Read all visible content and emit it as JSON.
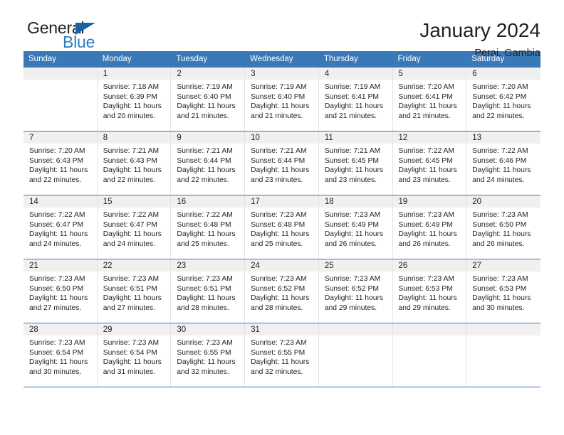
{
  "logo": {
    "word_one": "General",
    "word_two": "Blue",
    "triangle_color": "#1763a5",
    "blue_color": "#2b7cc4"
  },
  "header": {
    "title": "January 2024",
    "subtitle": "Perai, Gambia"
  },
  "colors": {
    "header_blue": "#3a79b8",
    "daynum_band": "#f0f0f0",
    "text": "#221f1f"
  },
  "weekday_headers": [
    "Sunday",
    "Monday",
    "Tuesday",
    "Wednesday",
    "Thursday",
    "Friday",
    "Saturday"
  ],
  "weeks": [
    [
      {
        "day": "",
        "sunrise": "",
        "sunset": "",
        "daylight_1": "",
        "daylight_2": ""
      },
      {
        "day": "1",
        "sunrise": "Sunrise: 7:18 AM",
        "sunset": "Sunset: 6:39 PM",
        "daylight_1": "Daylight: 11 hours",
        "daylight_2": "and 20 minutes."
      },
      {
        "day": "2",
        "sunrise": "Sunrise: 7:19 AM",
        "sunset": "Sunset: 6:40 PM",
        "daylight_1": "Daylight: 11 hours",
        "daylight_2": "and 21 minutes."
      },
      {
        "day": "3",
        "sunrise": "Sunrise: 7:19 AM",
        "sunset": "Sunset: 6:40 PM",
        "daylight_1": "Daylight: 11 hours",
        "daylight_2": "and 21 minutes."
      },
      {
        "day": "4",
        "sunrise": "Sunrise: 7:19 AM",
        "sunset": "Sunset: 6:41 PM",
        "daylight_1": "Daylight: 11 hours",
        "daylight_2": "and 21 minutes."
      },
      {
        "day": "5",
        "sunrise": "Sunrise: 7:20 AM",
        "sunset": "Sunset: 6:41 PM",
        "daylight_1": "Daylight: 11 hours",
        "daylight_2": "and 21 minutes."
      },
      {
        "day": "6",
        "sunrise": "Sunrise: 7:20 AM",
        "sunset": "Sunset: 6:42 PM",
        "daylight_1": "Daylight: 11 hours",
        "daylight_2": "and 22 minutes."
      }
    ],
    [
      {
        "day": "7",
        "sunrise": "Sunrise: 7:20 AM",
        "sunset": "Sunset: 6:43 PM",
        "daylight_1": "Daylight: 11 hours",
        "daylight_2": "and 22 minutes."
      },
      {
        "day": "8",
        "sunrise": "Sunrise: 7:21 AM",
        "sunset": "Sunset: 6:43 PM",
        "daylight_1": "Daylight: 11 hours",
        "daylight_2": "and 22 minutes."
      },
      {
        "day": "9",
        "sunrise": "Sunrise: 7:21 AM",
        "sunset": "Sunset: 6:44 PM",
        "daylight_1": "Daylight: 11 hours",
        "daylight_2": "and 22 minutes."
      },
      {
        "day": "10",
        "sunrise": "Sunrise: 7:21 AM",
        "sunset": "Sunset: 6:44 PM",
        "daylight_1": "Daylight: 11 hours",
        "daylight_2": "and 23 minutes."
      },
      {
        "day": "11",
        "sunrise": "Sunrise: 7:21 AM",
        "sunset": "Sunset: 6:45 PM",
        "daylight_1": "Daylight: 11 hours",
        "daylight_2": "and 23 minutes."
      },
      {
        "day": "12",
        "sunrise": "Sunrise: 7:22 AM",
        "sunset": "Sunset: 6:45 PM",
        "daylight_1": "Daylight: 11 hours",
        "daylight_2": "and 23 minutes."
      },
      {
        "day": "13",
        "sunrise": "Sunrise: 7:22 AM",
        "sunset": "Sunset: 6:46 PM",
        "daylight_1": "Daylight: 11 hours",
        "daylight_2": "and 24 minutes."
      }
    ],
    [
      {
        "day": "14",
        "sunrise": "Sunrise: 7:22 AM",
        "sunset": "Sunset: 6:47 PM",
        "daylight_1": "Daylight: 11 hours",
        "daylight_2": "and 24 minutes."
      },
      {
        "day": "15",
        "sunrise": "Sunrise: 7:22 AM",
        "sunset": "Sunset: 6:47 PM",
        "daylight_1": "Daylight: 11 hours",
        "daylight_2": "and 24 minutes."
      },
      {
        "day": "16",
        "sunrise": "Sunrise: 7:22 AM",
        "sunset": "Sunset: 6:48 PM",
        "daylight_1": "Daylight: 11 hours",
        "daylight_2": "and 25 minutes."
      },
      {
        "day": "17",
        "sunrise": "Sunrise: 7:23 AM",
        "sunset": "Sunset: 6:48 PM",
        "daylight_1": "Daylight: 11 hours",
        "daylight_2": "and 25 minutes."
      },
      {
        "day": "18",
        "sunrise": "Sunrise: 7:23 AM",
        "sunset": "Sunset: 6:49 PM",
        "daylight_1": "Daylight: 11 hours",
        "daylight_2": "and 26 minutes."
      },
      {
        "day": "19",
        "sunrise": "Sunrise: 7:23 AM",
        "sunset": "Sunset: 6:49 PM",
        "daylight_1": "Daylight: 11 hours",
        "daylight_2": "and 26 minutes."
      },
      {
        "day": "20",
        "sunrise": "Sunrise: 7:23 AM",
        "sunset": "Sunset: 6:50 PM",
        "daylight_1": "Daylight: 11 hours",
        "daylight_2": "and 26 minutes."
      }
    ],
    [
      {
        "day": "21",
        "sunrise": "Sunrise: 7:23 AM",
        "sunset": "Sunset: 6:50 PM",
        "daylight_1": "Daylight: 11 hours",
        "daylight_2": "and 27 minutes."
      },
      {
        "day": "22",
        "sunrise": "Sunrise: 7:23 AM",
        "sunset": "Sunset: 6:51 PM",
        "daylight_1": "Daylight: 11 hours",
        "daylight_2": "and 27 minutes."
      },
      {
        "day": "23",
        "sunrise": "Sunrise: 7:23 AM",
        "sunset": "Sunset: 6:51 PM",
        "daylight_1": "Daylight: 11 hours",
        "daylight_2": "and 28 minutes."
      },
      {
        "day": "24",
        "sunrise": "Sunrise: 7:23 AM",
        "sunset": "Sunset: 6:52 PM",
        "daylight_1": "Daylight: 11 hours",
        "daylight_2": "and 28 minutes."
      },
      {
        "day": "25",
        "sunrise": "Sunrise: 7:23 AM",
        "sunset": "Sunset: 6:52 PM",
        "daylight_1": "Daylight: 11 hours",
        "daylight_2": "and 29 minutes."
      },
      {
        "day": "26",
        "sunrise": "Sunrise: 7:23 AM",
        "sunset": "Sunset: 6:53 PM",
        "daylight_1": "Daylight: 11 hours",
        "daylight_2": "and 29 minutes."
      },
      {
        "day": "27",
        "sunrise": "Sunrise: 7:23 AM",
        "sunset": "Sunset: 6:53 PM",
        "daylight_1": "Daylight: 11 hours",
        "daylight_2": "and 30 minutes."
      }
    ],
    [
      {
        "day": "28",
        "sunrise": "Sunrise: 7:23 AM",
        "sunset": "Sunset: 6:54 PM",
        "daylight_1": "Daylight: 11 hours",
        "daylight_2": "and 30 minutes."
      },
      {
        "day": "29",
        "sunrise": "Sunrise: 7:23 AM",
        "sunset": "Sunset: 6:54 PM",
        "daylight_1": "Daylight: 11 hours",
        "daylight_2": "and 31 minutes."
      },
      {
        "day": "30",
        "sunrise": "Sunrise: 7:23 AM",
        "sunset": "Sunset: 6:55 PM",
        "daylight_1": "Daylight: 11 hours",
        "daylight_2": "and 32 minutes."
      },
      {
        "day": "31",
        "sunrise": "Sunrise: 7:23 AM",
        "sunset": "Sunset: 6:55 PM",
        "daylight_1": "Daylight: 11 hours",
        "daylight_2": "and 32 minutes."
      },
      {
        "day": "",
        "sunrise": "",
        "sunset": "",
        "daylight_1": "",
        "daylight_2": ""
      },
      {
        "day": "",
        "sunrise": "",
        "sunset": "",
        "daylight_1": "",
        "daylight_2": ""
      },
      {
        "day": "",
        "sunrise": "",
        "sunset": "",
        "daylight_1": "",
        "daylight_2": ""
      }
    ]
  ]
}
